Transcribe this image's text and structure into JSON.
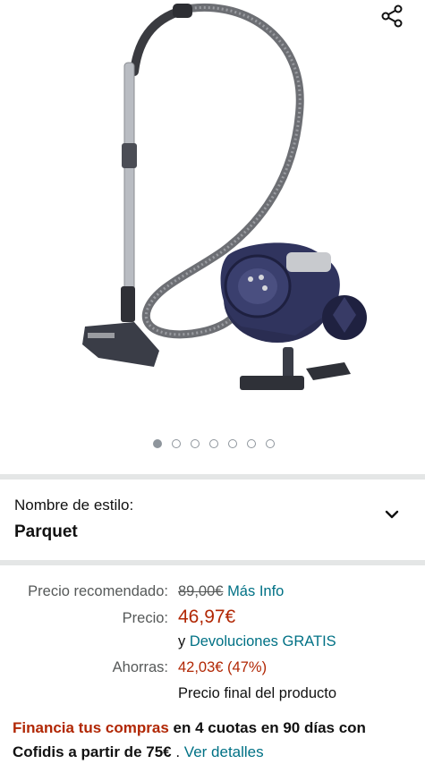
{
  "gallery": {
    "image_alt": "Hoover vacuum cleaner",
    "image_count": 7,
    "active_index": 0,
    "share_icon": "share-icon"
  },
  "style": {
    "label": "Nombre de estilo:",
    "value": "Parquet",
    "chevron_icon": "chevron-down-icon"
  },
  "pricing": {
    "recommended_label": "Precio recomendado:",
    "recommended_value": "89,00€",
    "more_info": "Más Info",
    "price_label": "Precio:",
    "price_value": "46,97€",
    "returns_prefix": "y",
    "returns_link": "Devoluciones GRATIS",
    "savings_label": "Ahorras:",
    "savings_value": "42,03€ (47%)",
    "final_note": "Precio final del producto"
  },
  "financing": {
    "link": "Financia tus compras",
    "text_1": " en 4 cuotas en 90 días con",
    "text_2": "Cofidis a partir de 75€",
    "sep": " . ",
    "details": "Ver detalles"
  },
  "colors": {
    "price_red": "#b12704",
    "link_teal": "#007185",
    "vacuum_navy": "#2a2d52"
  }
}
